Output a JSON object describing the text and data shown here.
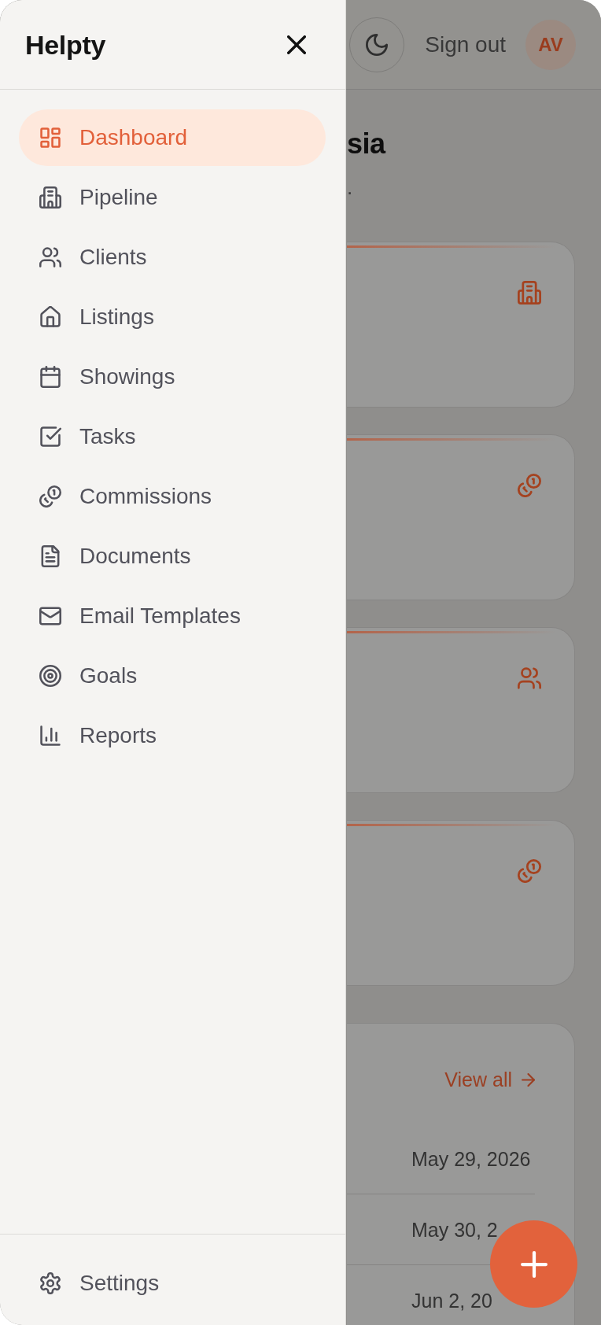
{
  "sidebar": {
    "brand": "Helpty",
    "nav": [
      {
        "label": "Dashboard",
        "selected": true
      },
      {
        "label": "Pipeline",
        "selected": false
      },
      {
        "label": "Clients",
        "selected": false
      },
      {
        "label": "Listings",
        "selected": false
      },
      {
        "label": "Showings",
        "selected": false
      },
      {
        "label": "Tasks",
        "selected": false
      },
      {
        "label": "Commissions",
        "selected": false
      },
      {
        "label": "Documents",
        "selected": false
      },
      {
        "label": "Email Templates",
        "selected": false
      },
      {
        "label": "Goals",
        "selected": false
      },
      {
        "label": "Reports",
        "selected": false
      }
    ],
    "settings": {
      "label": "Settings",
      "selected": false
    }
  },
  "header": {
    "sign_out": "Sign out",
    "avatar_initials": "AV"
  },
  "page": {
    "heading": "sia",
    "subtitle": "."
  },
  "upcoming": {
    "link": "View all",
    "rows": [
      {
        "date": "May 29, 2026"
      },
      {
        "date": "May 30, 2"
      },
      {
        "date": "Jun 2, 20"
      }
    ]
  }
}
